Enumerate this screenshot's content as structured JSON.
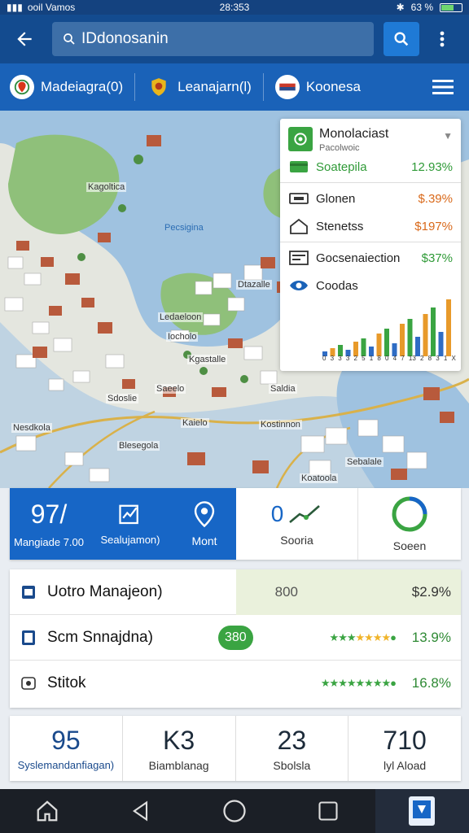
{
  "statusbar": {
    "carrier": "ooil Vamos",
    "time": "28:353",
    "battery": "63 %",
    "battery_level": 0.63
  },
  "header": {
    "search_value": "IDdonosanin"
  },
  "filters": [
    {
      "label": "Madeiagra(0)"
    },
    {
      "label": "Leanajarn(l)"
    },
    {
      "label": "Koonesa"
    }
  ],
  "map": {
    "labels": [
      "Kagoltica",
      "Pecsigina",
      "Ledaeloon",
      "Iocholo",
      "Dtazalle",
      "Kgastalle",
      "Saldia",
      "Saeelo",
      "Kaielo",
      "Sdoslie",
      "Kostinnon",
      "Blesegola",
      "Nesdkola",
      "Sebalale",
      "Koatoola"
    ]
  },
  "panel": {
    "title": "Monolaciast",
    "subtitle": "Pacolwoic",
    "rows": [
      {
        "label": "Soatepila",
        "value": "12.93%"
      },
      {
        "label": "Glonen",
        "value": "$.39%"
      },
      {
        "label": "Stenetss",
        "value": "$197%"
      },
      {
        "label": "Gocsenaiection",
        "value": "$37%"
      },
      {
        "label": "Coodas",
        "value": ""
      }
    ],
    "chart_ticks": [
      "0",
      "3",
      "3",
      "3",
      "2",
      "5",
      "1",
      "8",
      "0",
      "4",
      "7",
      "13",
      "2",
      "8",
      "3",
      "1",
      "X"
    ]
  },
  "stats": [
    {
      "value": "97/",
      "label": "Mangiade 7.00"
    },
    {
      "value": "",
      "label": "Sealujamon)"
    },
    {
      "value": "",
      "label": "Mont"
    },
    {
      "value": "0",
      "label": "Sooria"
    },
    {
      "value": "",
      "label": "Soeen"
    }
  ],
  "list": [
    {
      "name": "Uotro Manajeon)",
      "mid": "800",
      "value": "$2.9%"
    },
    {
      "name": "Scm Snnajdna)",
      "badge": "380",
      "value": "13.9%"
    },
    {
      "name": "Stitok",
      "value": "16.8%"
    }
  ],
  "kpis": [
    {
      "value": "95",
      "label": "Syslemandanfiagan)"
    },
    {
      "value": "K3",
      "label": "Biamblanag"
    },
    {
      "value": "23",
      "label": "Sbolsla"
    },
    {
      "value": "710",
      "label": "lyl Aload"
    }
  ],
  "colors": {
    "primary": "#134b8f",
    "accent": "#1766c6",
    "positive": "#2f9a37",
    "warning": "#d9691a"
  }
}
